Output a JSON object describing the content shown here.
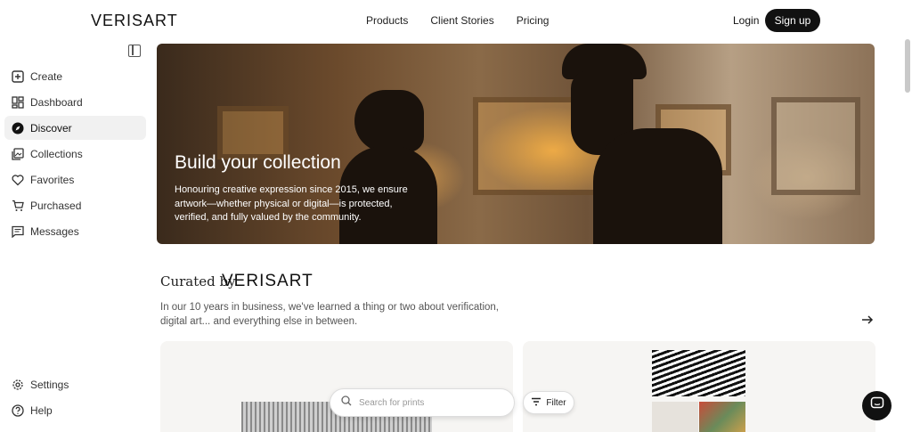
{
  "header": {
    "logo": "VERISART",
    "nav": [
      "Products",
      "Client Stories",
      "Pricing"
    ],
    "login": "Login",
    "signup": "Sign up"
  },
  "sidebar": {
    "items": [
      {
        "label": "Create",
        "icon": "plus-square-icon"
      },
      {
        "label": "Dashboard",
        "icon": "dashboard-icon"
      },
      {
        "label": "Discover",
        "icon": "compass-icon",
        "active": true
      },
      {
        "label": "Collections",
        "icon": "collections-icon"
      },
      {
        "label": "Favorites",
        "icon": "heart-icon"
      },
      {
        "label": "Purchased",
        "icon": "cart-icon"
      },
      {
        "label": "Messages",
        "icon": "message-icon"
      }
    ],
    "bottom": [
      {
        "label": "Settings",
        "icon": "gear-icon"
      },
      {
        "label": "Help",
        "icon": "help-icon"
      }
    ]
  },
  "hero": {
    "title": "Build your collection",
    "text": "Honouring creative expression since 2015, we ensure artwork—whether physical or digital—is protected, verified, and fully valued by the community."
  },
  "curated": {
    "label": "Curated by",
    "brand": "VERISART",
    "description": "In our 10 years in business, we've learned a thing or two about verification, digital art... and everything else in between."
  },
  "search": {
    "placeholder": "Search for prints",
    "filter_label": "Filter"
  }
}
